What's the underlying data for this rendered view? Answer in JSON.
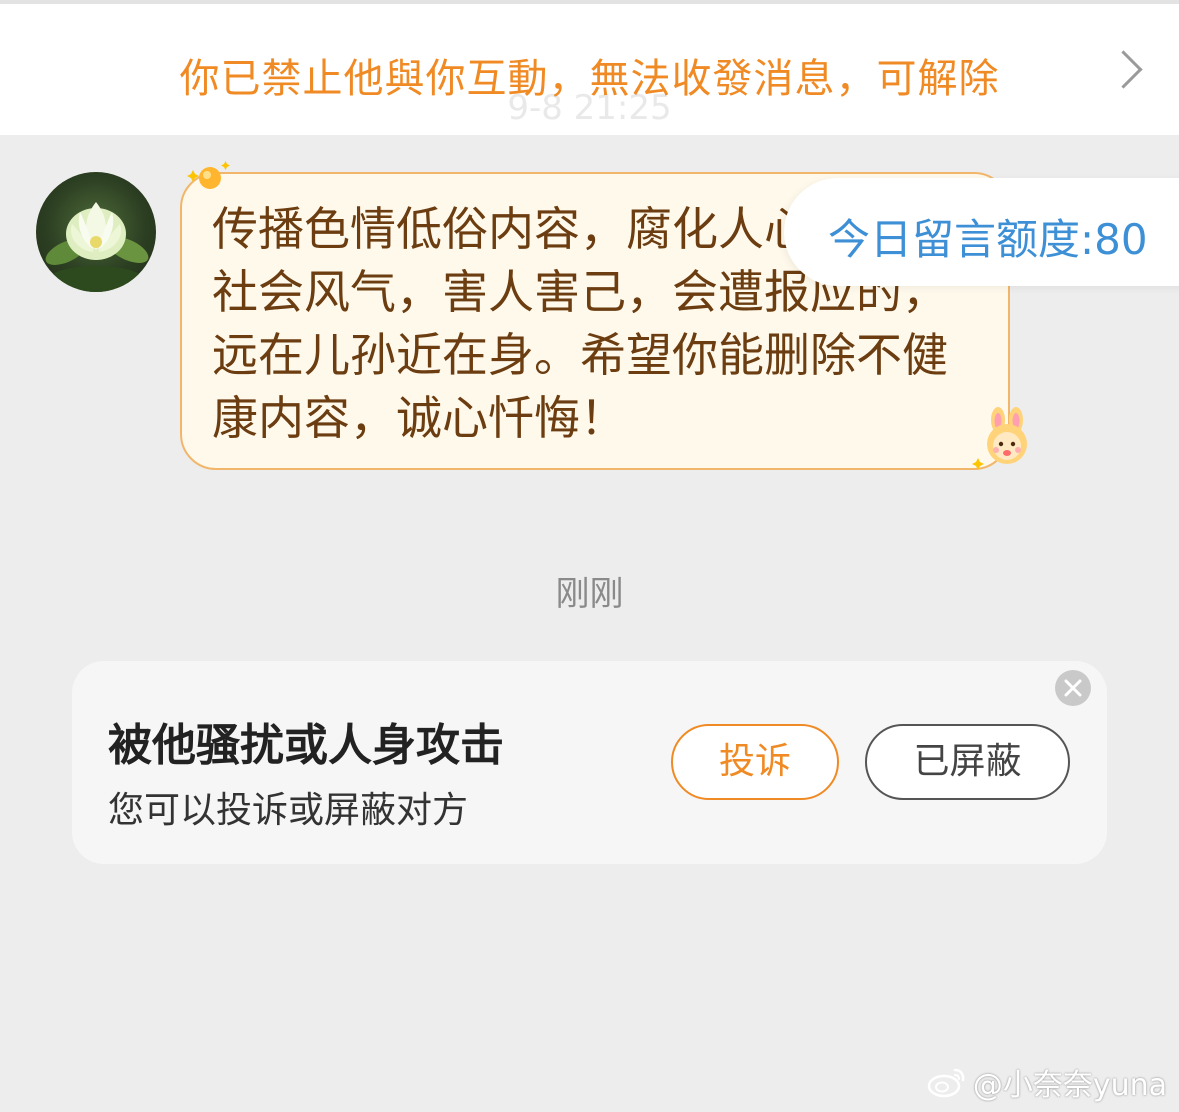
{
  "banner": {
    "text": "你已禁止他與你互動，無法收發消息，可解除",
    "faded_timestamp": "9-8 21:25",
    "chevron_icon": "chevron-right-icon"
  },
  "message": {
    "text": "传播色情低俗内容，腐化人心，败坏社会风气，害人害己，会遭报应的，远在儿孙近在身。希望你能删除不健康内容，诚心忏悔！",
    "bubble_border_color": "#f2b66b",
    "text_color": "#6b3d10"
  },
  "quota": {
    "text": "今日留言额度:80",
    "color": "#3d8fd6"
  },
  "timestamp": "刚刚",
  "harassment_card": {
    "title": "被他骚扰或人身攻击",
    "subtitle": "您可以投诉或屏蔽对方",
    "report_label": "投诉",
    "blocked_label": "已屏蔽",
    "accent_color": "#f08a24"
  },
  "watermark": {
    "text": "@小奈奈yuna",
    "icon": "weibo-logo-icon"
  }
}
